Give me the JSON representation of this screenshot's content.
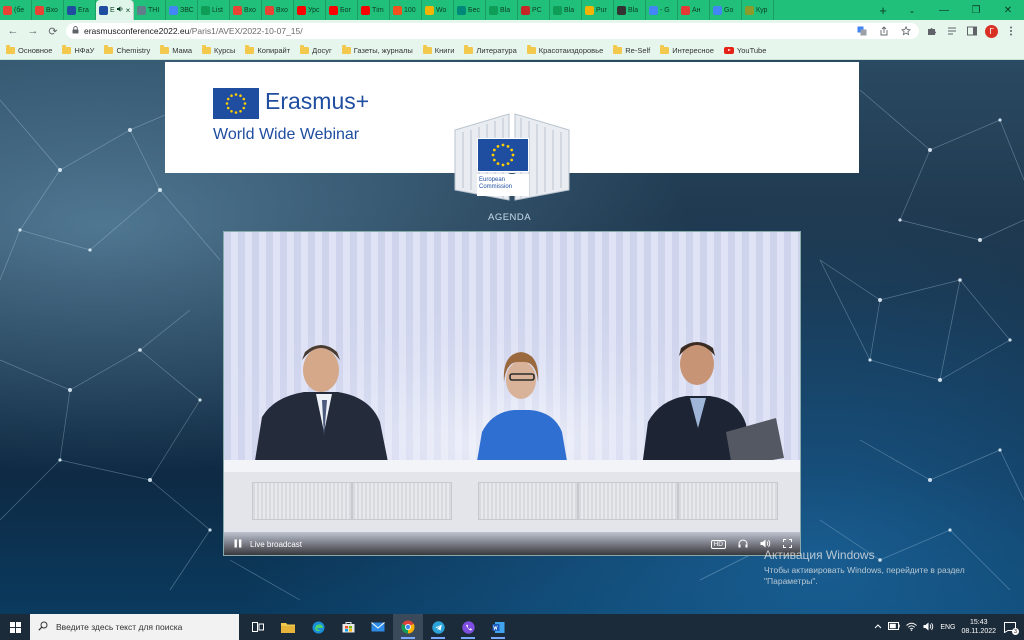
{
  "browser": {
    "tabs": [
      {
        "label": "(бе",
        "color": "#ea4335",
        "icon": "gmail-icon"
      },
      {
        "label": "Вхо",
        "color": "#ea4335",
        "icon": "gmail-icon"
      },
      {
        "label": "Era",
        "color": "#1f4ea1",
        "icon": "eu-flag-icon"
      },
      {
        "label": "E",
        "color": "#1f4ea1",
        "icon": "eu-flag-icon",
        "active": true
      },
      {
        "label": "THI",
        "color": "#607d8b",
        "icon": "web-icon"
      },
      {
        "label": "ЗВС",
        "color": "#4285f4",
        "icon": "docs-icon"
      },
      {
        "label": "List",
        "color": "#0f9d58",
        "icon": "plus-icon"
      },
      {
        "label": "Вхо",
        "color": "#ea4335",
        "icon": "gmail-icon"
      },
      {
        "label": "Вхо",
        "color": "#ea4335",
        "icon": "gmail-icon"
      },
      {
        "label": "Урс",
        "color": "#ff0000",
        "icon": "youtube-icon"
      },
      {
        "label": "Бог",
        "color": "#ff0000",
        "icon": "youtube-icon"
      },
      {
        "label": "Тim",
        "color": "#ff0000",
        "icon": "youtube-icon"
      },
      {
        "label": "100",
        "color": "#f4511e",
        "icon": "f-icon"
      },
      {
        "label": "Wo",
        "color": "#f4b400",
        "icon": "keep-icon"
      },
      {
        "label": "Бес",
        "color": "#00897b",
        "icon": "d-icon"
      },
      {
        "label": "Bla",
        "color": "#0f9d58",
        "icon": "plus-icon"
      },
      {
        "label": "PC",
        "color": "#c62828",
        "icon": "grid-icon"
      },
      {
        "label": "Bla",
        "color": "#0f9d58",
        "icon": "plus-icon"
      },
      {
        "label": "Pur",
        "color": "#f4b400",
        "icon": "p-icon"
      },
      {
        "label": "Bla",
        "color": "#333333",
        "icon": "bp-icon"
      },
      {
        "label": "- G",
        "color": "#4285f4",
        "icon": "ua-icon"
      },
      {
        "label": "Ан",
        "color": "#e53935",
        "icon": "g-icon"
      },
      {
        "label": "Go",
        "color": "#4285f4",
        "icon": "translate-icon"
      },
      {
        "label": "Кур",
        "color": "#8d9b2a",
        "icon": "image-icon"
      }
    ],
    "new_tab": "+",
    "window": {
      "chevron": "⌄",
      "minimize": "—",
      "restore": "❐",
      "close": "✕"
    },
    "nav": {
      "back": "←",
      "forward": "→",
      "reload": "⟳"
    },
    "url": {
      "domain": "erasmusconference2022.eu",
      "path": "/Paris1/AVEX/2022-10-07_15/"
    },
    "profile_initial": "Г",
    "bookmarks": [
      {
        "label": "Основное",
        "icon": "folder-icon"
      },
      {
        "label": "НФаУ",
        "icon": "folder-icon"
      },
      {
        "label": "Chemistry",
        "icon": "folder-icon"
      },
      {
        "label": "Мама",
        "icon": "folder-icon"
      },
      {
        "label": "Курсы",
        "icon": "folder-icon"
      },
      {
        "label": "Копирайт",
        "icon": "folder-icon"
      },
      {
        "label": "Досуг",
        "icon": "folder-icon"
      },
      {
        "label": "Газеты, журналы",
        "icon": "folder-icon"
      },
      {
        "label": "Книги",
        "icon": "folder-icon"
      },
      {
        "label": "Литература",
        "icon": "folder-icon"
      },
      {
        "label": "Красотаиздоровье",
        "icon": "folder-icon"
      },
      {
        "label": "Re-Self",
        "icon": "folder-icon"
      },
      {
        "label": "Интересное",
        "icon": "folder-icon"
      },
      {
        "label": "YouTube",
        "icon": "youtube-icon"
      }
    ]
  },
  "page": {
    "brand": "Erasmus+",
    "subtitle": "World Wide Webinar",
    "commission_line1": "European",
    "commission_line2": "Commission",
    "agenda": "AGENDA",
    "video": {
      "live_label": "Live broadcast",
      "hd_label": "HD"
    }
  },
  "activation": {
    "title": "Активация Windows",
    "line1": "Чтобы активировать Windows, перейдите в раздел",
    "line2": "\"Параметры\"."
  },
  "taskbar": {
    "search_placeholder": "Введите здесь текст для поиска",
    "lang": "ENG",
    "time": "15:43",
    "date": "08.11.2022",
    "notification_count": "3"
  },
  "colors": {
    "tabstrip": "#21c07a",
    "eu_blue": "#1f4ea1",
    "eu_star": "#ffcc00"
  }
}
